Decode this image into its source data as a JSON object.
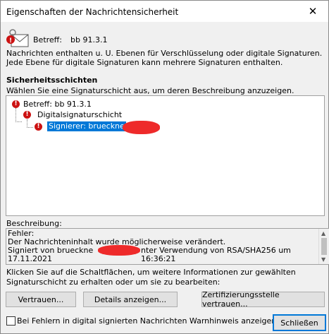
{
  "window": {
    "title": "Eigenschaften der Nachrichtensicherheit",
    "close_icon": "close-icon"
  },
  "header": {
    "subject_label": "Betreff:",
    "subject_value": "bb 91.3.1"
  },
  "info_text": "Nachrichten enthalten u. U. Ebenen für Verschlüsselung oder digitale Signaturen. Jede Ebene für digitale Signaturen kann mehrere Signaturen enthalten.",
  "layers": {
    "title": "Sicherheitsschichten",
    "instruction": "Wählen Sie eine Signaturschicht aus, um deren Beschreibung anzuzeigen.",
    "items": [
      {
        "label": "Betreff: bb 91.3.1",
        "icon": "error-icon"
      },
      {
        "label": "Digitalsignaturschicht",
        "icon": "error-icon"
      },
      {
        "label": "Signierer: brueckne",
        "icon": "error-icon",
        "selected": true
      }
    ]
  },
  "description": {
    "label": "Beschreibung:",
    "lines": [
      "Fehler:",
      "Der Nachrichteninhalt wurde möglicherweise verändert.",
      "Signiert von brueckne",
      "nter Verwendung von RSA/SHA256 um 16:36:21",
      "17.11.2021"
    ]
  },
  "hint": "Klicken Sie auf die Schaltflächen, um weitere Informationen zur gewählten Signaturschicht zu erhalten oder um sie zu bearbeiten:",
  "buttons": {
    "trust": "Vertrauen...",
    "details": "Details anzeigen...",
    "trust_ca": "Zertifizierungsstelle vertrauen...",
    "close": "Schließen"
  },
  "checkbox": {
    "label": "Bei Fehlern in digital signierten Nachrichten Warnhinweis anzeigen.",
    "checked": false
  },
  "colors": {
    "selection": "#0078d7",
    "error": "#cc1212",
    "redaction": "#ee2a2a"
  }
}
